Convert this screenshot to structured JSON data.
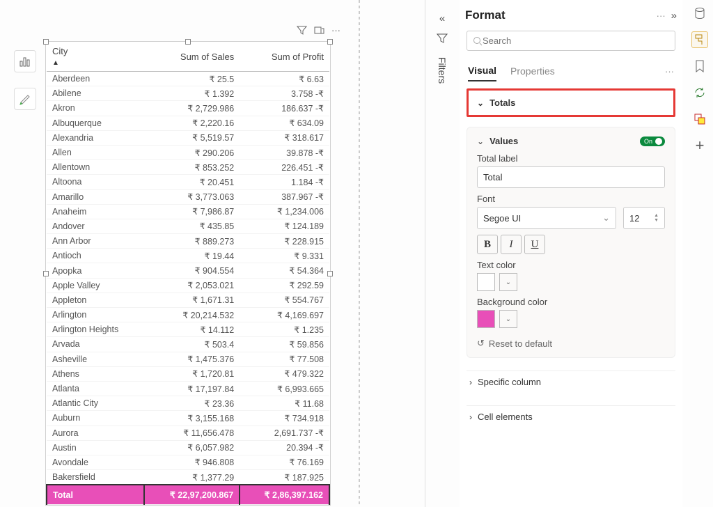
{
  "table": {
    "col_city": "City",
    "col_sales": "Sum of Sales",
    "col_profit": "Sum of Profit",
    "rows": [
      {
        "c": "Aberdeen",
        "s": "₹ 25.5",
        "p": "₹ 6.63"
      },
      {
        "c": "Abilene",
        "s": "₹ 1.392",
        "p": "3.758 -₹"
      },
      {
        "c": "Akron",
        "s": "₹ 2,729.986",
        "p": "186.637 -₹"
      },
      {
        "c": "Albuquerque",
        "s": "₹ 2,220.16",
        "p": "₹ 634.09"
      },
      {
        "c": "Alexandria",
        "s": "₹ 5,519.57",
        "p": "₹ 318.617"
      },
      {
        "c": "Allen",
        "s": "₹ 290.206",
        "p": "39.878 -₹"
      },
      {
        "c": "Allentown",
        "s": "₹ 853.252",
        "p": "226.451 -₹"
      },
      {
        "c": "Altoona",
        "s": "₹ 20.451",
        "p": "1.184 -₹"
      },
      {
        "c": "Amarillo",
        "s": "₹ 3,773.063",
        "p": "387.967 -₹"
      },
      {
        "c": "Anaheim",
        "s": "₹ 7,986.87",
        "p": "₹ 1,234.006"
      },
      {
        "c": "Andover",
        "s": "₹ 435.85",
        "p": "₹ 124.189"
      },
      {
        "c": "Ann Arbor",
        "s": "₹ 889.273",
        "p": "₹ 228.915"
      },
      {
        "c": "Antioch",
        "s": "₹ 19.44",
        "p": "₹ 9.331"
      },
      {
        "c": "Apopka",
        "s": "₹ 904.554",
        "p": "₹ 54.364"
      },
      {
        "c": "Apple Valley",
        "s": "₹ 2,053.021",
        "p": "₹ 292.59"
      },
      {
        "c": "Appleton",
        "s": "₹ 1,671.31",
        "p": "₹ 554.767"
      },
      {
        "c": "Arlington",
        "s": "₹ 20,214.532",
        "p": "₹ 4,169.697"
      },
      {
        "c": "Arlington Heights",
        "s": "₹ 14.112",
        "p": "₹ 1.235"
      },
      {
        "c": "Arvada",
        "s": "₹ 503.4",
        "p": "₹ 59.856"
      },
      {
        "c": "Asheville",
        "s": "₹ 1,475.376",
        "p": "₹ 77.508"
      },
      {
        "c": "Athens",
        "s": "₹ 1,720.81",
        "p": "₹ 479.322"
      },
      {
        "c": "Atlanta",
        "s": "₹ 17,197.84",
        "p": "₹ 6,993.665"
      },
      {
        "c": "Atlantic City",
        "s": "₹ 23.36",
        "p": "₹ 11.68"
      },
      {
        "c": "Auburn",
        "s": "₹ 3,155.168",
        "p": "₹ 734.918"
      },
      {
        "c": "Aurora",
        "s": "₹ 11,656.478",
        "p": "2,691.737 -₹"
      },
      {
        "c": "Austin",
        "s": "₹ 6,057.982",
        "p": "20.394 -₹"
      },
      {
        "c": "Avondale",
        "s": "₹ 946.808",
        "p": "₹ 76.169"
      },
      {
        "c": "Bakersfield",
        "s": "₹ 1,377.29",
        "p": "₹ 187.925"
      }
    ],
    "total_label": "Total",
    "total_sales": "₹ 22,97,200.867",
    "total_profit": "₹ 2,86,397.162"
  },
  "filters": {
    "label": "Filters"
  },
  "format": {
    "title": "Format",
    "search_placeholder": "Search",
    "tab_visual": "Visual",
    "tab_properties": "Properties",
    "section_totals": "Totals",
    "values_label": "Values",
    "values_toggle": "On",
    "total_label_field": "Total label",
    "total_label_value": "Total",
    "font_label": "Font",
    "font_value": "Segoe UI",
    "font_size": "12",
    "text_color_label": "Text color",
    "text_color": "#ffffff",
    "bg_color_label": "Background color",
    "bg_color": "#e84fb8",
    "reset": "Reset to default",
    "specific_column": "Specific column",
    "cell_elements": "Cell elements"
  },
  "icons": {
    "more": "···",
    "expand_left": "«",
    "expand_right": "»"
  }
}
